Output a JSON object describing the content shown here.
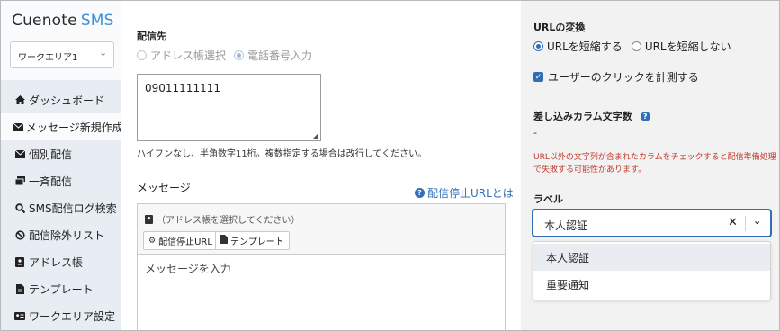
{
  "sidebar": {
    "logo_main": "Cuenote",
    "logo_accent": "SMS",
    "workarea": "ワークエリア1",
    "items": [
      {
        "label": "ダッシュボード",
        "icon": "home-icon"
      },
      {
        "label": "メッセージ新規作成",
        "icon": "envelope-icon"
      },
      {
        "label": "個別配信",
        "icon": "envelope-icon"
      },
      {
        "label": "一斉配信",
        "icon": "stack-icon"
      },
      {
        "label": "SMS配信ログ検索",
        "icon": "search-icon"
      },
      {
        "label": "配信除外リスト",
        "icon": "ban-icon"
      },
      {
        "label": "アドレス帳",
        "icon": "addressbook-icon"
      },
      {
        "label": "テンプレート",
        "icon": "document-icon"
      },
      {
        "label": "ワークエリア設定",
        "icon": "id-card-icon"
      }
    ]
  },
  "main": {
    "destination_label": "配信先",
    "radio_addressbook": "アドレス帳選択",
    "radio_phone": "電話番号入力",
    "phone_value": "09011111111",
    "phone_hint": "ハイフンなし、半角数字11桁。複数指定する場合は改行してください。",
    "message_label": "メッセージ",
    "stop_url_help": "配信停止URLとは",
    "addressbook_hint": "（アドレス帳を選択してください）",
    "btn_stop_url": "配信停止URL",
    "btn_template": "テンプレート",
    "message_placeholder": "メッセージを入力"
  },
  "right": {
    "url_conversion_title": "URLの変換",
    "radio_shorten": "URLを短縮する",
    "radio_no_shorten": "URLを短縮しない",
    "track_click_label": "ユーザーのクリックを計測する",
    "column_count_title": "差し込みカラム文字数",
    "column_count_value": "-",
    "warning": "URL以外の文字列が含まれたカラムをチェックすると配信準備処理で失敗する可能性があります。",
    "label_title": "ラベル",
    "label_selected": "本人認証",
    "label_options": [
      "本人認証",
      "重要通知"
    ]
  },
  "colors": {
    "accent": "#2f6fb7",
    "sidebar_bg": "#e8edf3",
    "right_panel_bg": "#f2f2f2",
    "warning": "#c0392b"
  }
}
